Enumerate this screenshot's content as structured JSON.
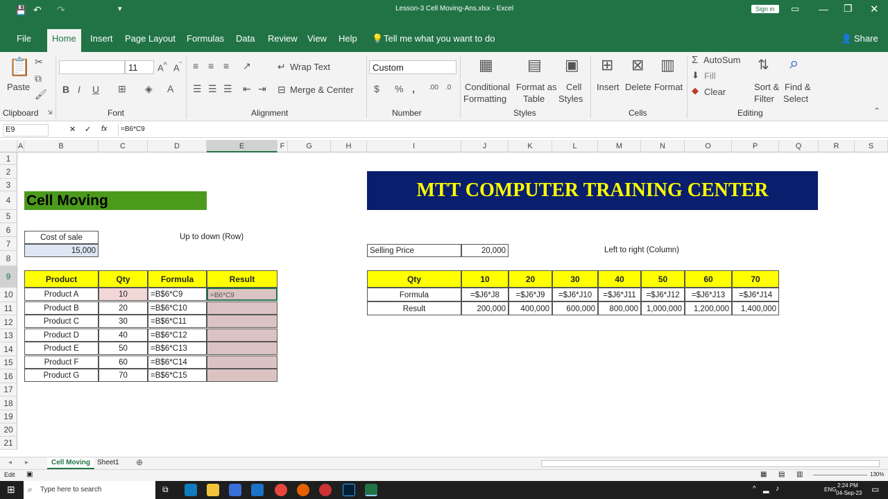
{
  "title": {
    "text": "Lesson-3 Cell Moving-Ans.xlsx - Excel",
    "sign_in": "Sign in"
  },
  "tabs": [
    "File",
    "Home",
    "Insert",
    "Page Layout",
    "Formulas",
    "Data",
    "Review",
    "View",
    "Help"
  ],
  "tell_me": "Tell me what you want to do",
  "share": "Share",
  "ribbon": {
    "paste": "Paste",
    "clipboard": "Clipboard",
    "font_size": "11",
    "font_group": "Font",
    "bold": "B",
    "italic": "I",
    "underline": "U",
    "wrap_text": "Wrap Text",
    "merge_center": "Merge & Center",
    "alignment": "Alignment",
    "number_format": "Custom",
    "number": "Number",
    "currency": "$",
    "percent": "%",
    "comma": ",",
    "cond_format_1": "Conditional",
    "cond_format_2": "Formatting",
    "format_table_1": "Format as",
    "format_table_2": "Table",
    "cell_styles_1": "Cell",
    "cell_styles_2": "Styles",
    "styles": "Styles",
    "insert": "Insert",
    "delete": "Delete",
    "format": "Format",
    "cells": "Cells",
    "autosum": "AutoSum",
    "fill": "Fill",
    "clear": "Clear",
    "sort_1": "Sort &",
    "sort_2": "Filter",
    "find_1": "Find &",
    "find_2": "Select",
    "editing": "Editing"
  },
  "formula_bar": {
    "name_box": "E9",
    "fx": "fx",
    "formula": "=B6*C9"
  },
  "columns": [
    "A",
    "B",
    "C",
    "D",
    "E",
    "F",
    "G",
    "H",
    "I",
    "J",
    "K",
    "L",
    "M",
    "N",
    "O",
    "P",
    "Q",
    "R",
    "S"
  ],
  "rows": [
    "1",
    "2",
    "3",
    "4",
    "5",
    "6",
    "7",
    "8",
    "9",
    "10",
    "11",
    "12",
    "13",
    "14",
    "15",
    "16",
    "17",
    "18",
    "19",
    "20",
    "21"
  ],
  "sheet": {
    "banner": "MTT COMPUTER TRAINING CENTER",
    "heading": "Cell Moving",
    "cost_label": "Cost of sale",
    "cost_value": "15,000",
    "up_down": "Up to down (Row)",
    "selling_label": "Selling Price",
    "selling_value": "20,000",
    "left_right": "Left to right (Column)",
    "left_headers": [
      "Product",
      "Qty",
      "Formula",
      "Result"
    ],
    "left_rows": [
      [
        "Product A",
        "10",
        "=B$6*C9",
        "=B6*C9"
      ],
      [
        "Product B",
        "20",
        "=B$6*C10",
        ""
      ],
      [
        "Product C",
        "30",
        "=B$6*C11",
        ""
      ],
      [
        "Product D",
        "40",
        "=B$6*C12",
        ""
      ],
      [
        "Product E",
        "50",
        "=B$6*C13",
        ""
      ],
      [
        "Product F",
        "60",
        "=B$6*C14",
        ""
      ],
      [
        "Product G",
        "70",
        "=B$6*C15",
        ""
      ]
    ],
    "right_headers": [
      "Qty",
      "10",
      "20",
      "30",
      "40",
      "50",
      "60",
      "70"
    ],
    "right_formula": [
      "Formula",
      "=$J6*J8",
      "=$J6*J9",
      "=$J6*J10",
      "=$J6*J11",
      "=$J6*J12",
      "=$J6*J13",
      "=$J6*J14"
    ],
    "right_result": [
      "Result",
      "200,000",
      "400,000",
      "600,000",
      "800,000",
      "1,000,000",
      "1,200,000",
      "1,400,000"
    ]
  },
  "sheet_tabs": [
    "Cell Moving",
    "Sheet1"
  ],
  "status": {
    "mode": "Edit",
    "zoom": "130%"
  },
  "taskbar": {
    "search": "Type here to search",
    "time": "2:24 PM",
    "date": "04-Sep-23",
    "lang": "ENG"
  },
  "colors": {
    "excel_green": "#217346",
    "banner_bg": "#0a1e6e",
    "banner_text": "#ffff00",
    "heading_bg": "#4c9a1c",
    "header_yellow": "#ffff00",
    "result_fill": "#dcc3c3"
  }
}
